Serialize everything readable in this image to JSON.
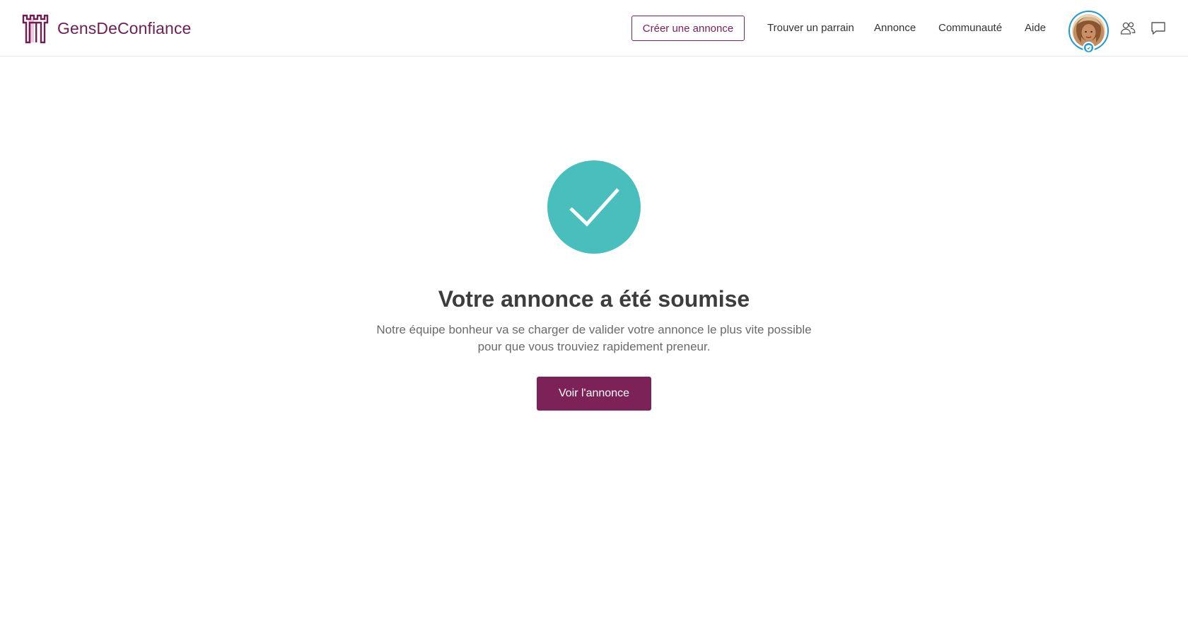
{
  "header": {
    "brand": "GensDeConfiance",
    "create_button": "Créer une annonce",
    "nav": {
      "find_sponsor": "Trouver un parrain",
      "listing": "Annonce",
      "community": "Communauté",
      "help": "Aide"
    },
    "icons": {
      "logo": "castle-logo-icon",
      "verified_badge": "shield-icon",
      "community": "people-icon",
      "messages": "chat-bubble-icon"
    }
  },
  "confirmation": {
    "icon": "check-icon",
    "title": "Votre annonce a été soumise",
    "line1": "Notre équipe bonheur va se charger de valider votre annonce le plus vite possible",
    "line2": "pour que vous trouviez rapidement preneur.",
    "view_button": "Voir l'annonce"
  },
  "colors": {
    "brand": "#7c2258",
    "success": "#48bfbd",
    "verified": "#1c9ad6"
  }
}
